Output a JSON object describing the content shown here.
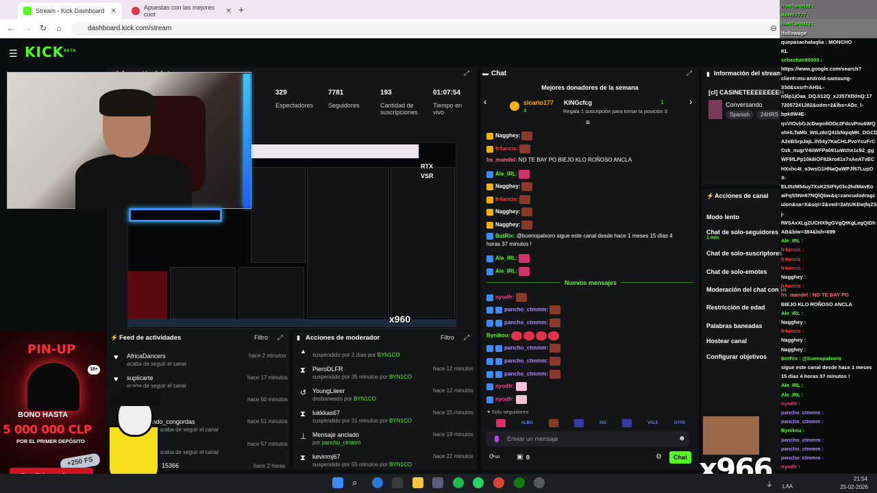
{
  "browser": {
    "tabs": [
      {
        "title": "Stream - Kick Dashboard",
        "close": "✕"
      },
      {
        "title": "Apuestas con las mejores cuot",
        "close": "✕"
      }
    ],
    "new_tab": "+",
    "url": "dashboard.kick.com/stream"
  },
  "kick": {
    "logo": "KICK",
    "logo_sup": "BETA"
  },
  "stream": {
    "title_partial": "Información del stream",
    "stats": [
      {
        "value": "329",
        "label": "Espectadores"
      },
      {
        "value": "7781",
        "label": "Seguidores"
      },
      {
        "value": "193",
        "label": "Cantidad de suscripciones"
      },
      {
        "value": "01:07:54",
        "label": "Tiempo en vivo"
      }
    ],
    "preview_labels": {
      "rtx": "RTX",
      "vsr": "VSR",
      "multiplier": "x960"
    }
  },
  "feed": {
    "title": "Feed de actividades",
    "filter": "Filtro",
    "items": [
      {
        "name": "AfricaDancers",
        "sub": "acaba de seguir el canal",
        "time": "hace 2 minutos"
      },
      {
        "name": "suplicarte",
        "sub": "acaba de seguir el canal",
        "time": "hace 17 minutos"
      },
      {
        "name": "",
        "sub": "",
        "time": "hace 50 minutos"
      },
      {
        "name": "mondo_congordas",
        "sub": "acaba de seguir el canal",
        "time": "hace 51 minutos"
      },
      {
        "name": "",
        "sub": "acaba de seguir el canal",
        "time": "hace 57 minutos"
      },
      {
        "name": "15366",
        "sub": "",
        "time": "hace 2 horas"
      }
    ]
  },
  "mod": {
    "title": "Acciones de moderador",
    "filter": "Filtro",
    "items": [
      {
        "name": "",
        "sub": "suspendido por 2 días por",
        "by": "BYN1CO",
        "time": ""
      },
      {
        "name": "PieroDLFR",
        "sub": "suspendido por 35 minutos por",
        "by": "BYN1CO",
        "time": "hace 12 minutos"
      },
      {
        "name": "YoungLiieer",
        "sub": "desbaneado por",
        "by": "BYN1CO",
        "time": "hace 12 minutos"
      },
      {
        "name": "lukkkas67",
        "sub": "suspendido por 31 minutos por",
        "by": "BYN1CO",
        "time": "hace 15 minutos"
      },
      {
        "name": "Mensaje anclado",
        "sub": "por",
        "by": "pancho_ctmmm",
        "time": "hace 19 minutos"
      },
      {
        "name": "kevinmj67",
        "sub": "suspendido por 55 minutos por",
        "by": "BYN1CO",
        "time": "hace 22 minutos"
      }
    ]
  },
  "chat": {
    "title": "Chat",
    "top_donors_title": "Mejores donadores de la semana",
    "donor1": {
      "name": "sicario177",
      "count": "4"
    },
    "donor2": {
      "name": "KINGcfcg",
      "count": "1",
      "sub": "Regala 1 suscripción para tomar la posición 3"
    },
    "messages": [
      {
        "user": "Nagghey:",
        "text": "",
        "color": "#ffffff"
      },
      {
        "user": "fr4ancis:",
        "text": "",
        "color": "#ff3b3b"
      },
      {
        "user": "hs_mandel:",
        "text": "NO TE BAY PO BIEJO KLO ROÑOSO ANCLA",
        "color": "#ff6b8a"
      },
      {
        "user": "Ale_IRL:",
        "text": "",
        "color": "#53fc18"
      },
      {
        "user": "Nagghey:",
        "text": "",
        "color": "#ffffff"
      },
      {
        "user": "fr4ancis:",
        "text": "",
        "color": "#ff3b3b"
      },
      {
        "user": "Nagghey:",
        "text": "",
        "color": "#ffffff"
      },
      {
        "user": "Nagghey:",
        "text": "",
        "color": "#ffffff"
      },
      {
        "user": "BotRix:",
        "text": "@buenopalxoro sigue este canal desde hace 1 meses 15 días 4",
        "color": "#53fc18"
      },
      {
        "user": "",
        "text": "horas 37 minutos !",
        "color": "#ffffff"
      },
      {
        "user": "Ale_IRL:",
        "text": "",
        "color": "#53fc18"
      },
      {
        "user": "Ale_IRL:",
        "text": "",
        "color": "#53fc18"
      }
    ],
    "new_messages": "Nuevos mensajes",
    "new": [
      {
        "user": "nyodfr:",
        "color": "#ff3b8a"
      },
      {
        "user": "pancho_ctmmm:",
        "color": "#b18cff"
      },
      {
        "user": "pancho_ctmmm:",
        "color": "#b18cff"
      },
      {
        "user": "Bynikou:",
        "color": "#53fc18"
      },
      {
        "user": "pancho_ctmmm:",
        "color": "#b18cff"
      },
      {
        "user": "pancho_ctmmm:",
        "color": "#b18cff"
      },
      {
        "user": "pancho_ctmmm:",
        "color": "#b18cff"
      },
      {
        "user": "nyodfr:",
        "color": "#ff3b8a"
      },
      {
        "user": "nyodfr:",
        "color": "#ff3b8a"
      }
    ],
    "followers_only": "Solo seguidores",
    "emote_labels": [
      "ALBO",
      "SIU",
      "VALE",
      "GYPE"
    ],
    "input_placeholder": "Enviar un mensaje",
    "points": "0",
    "send": "Chat"
  },
  "info": {
    "title": "Información del stream",
    "stream_name": "[cl] CASINETEEEEEEEEH",
    "category": "Conversando",
    "tags": [
      "Spanish",
      "24HRS"
    ]
  },
  "actions": {
    "title": "Acciones de canal",
    "items": [
      {
        "label": "Modo lento",
        "sub": ""
      },
      {
        "label": "Chat de solo-seguidores",
        "sub": "1 min"
      },
      {
        "label": "Chat de solo-suscriptores",
        "sub": ""
      },
      {
        "label": "Chat de solo-emotes",
        "sub": ""
      },
      {
        "label": "Moderación del chat con IA",
        "sub": ""
      },
      {
        "label": "Restricción de edad",
        "sub": ""
      },
      {
        "label": "Palabras baneadas",
        "sub": ""
      },
      {
        "label": "Hostear canal",
        "sub": ""
      },
      {
        "label": "Configurar objetivos",
        "sub": ""
      }
    ]
  },
  "overlay_chat": [
    {
      "text": "huerfanozzz :",
      "color": "#53fc18"
    },
    {
      "text": "AcHE7777 :",
      "color": "#53fc18"
    },
    {
      "text": "huerfanozzz :",
      "color": "#53fc18"
    },
    {
      "text": "!followage",
      "color": "#ffffff"
    },
    {
      "text": "quepasachalaqlia : MONCHO",
      "color": "#ffffff"
    },
    {
      "text": "KL",
      "color": "#ffffff"
    },
    {
      "text": "sebastian89903 :",
      "color": "#53fc18"
    },
    {
      "text": "https://www.google.com/search?",
      "color": "#ffffff"
    },
    {
      "text": "client=ms-android-samsung-",
      "color": "#ffffff"
    },
    {
      "text": "33d&sxsrf=AHbL-",
      "color": "#ffffff"
    },
    {
      "text": "n5lp1jOaa_DQJi12Q_xJ357XD0nQ:17",
      "color": "#ffffff"
    },
    {
      "text": "72057241282&udm=2&lbs=ADc_l-",
      "color": "#ffffff"
    },
    {
      "text": "bpk8W4E-",
      "color": "#ffffff"
    },
    {
      "text": "qsVIOvbGJcDwpn6ODc2FdcvPnu6WQ",
      "color": "#ffffff"
    },
    {
      "text": "ohHLTaMb_WtLz8zQ41bNqiqMK_DGCD",
      "color": "#ffffff"
    },
    {
      "text": "A2eBSrpJajL.lh54y7KaCHLPvoYcuFrC",
      "color": "#ffffff"
    },
    {
      "text": "Ozk_nugrV4iiWFPa091uWzhe1c92_gg",
      "color": "#ffffff"
    },
    {
      "text": "WF9fLPp10k8iOF82kro81x7xAeATvEC",
      "color": "#ffffff"
    },
    {
      "text": "HXxhc4t_o3wsG1HNaQaWPJf67LupO",
      "color": "#ffffff"
    },
    {
      "text": "X-",
      "color": "#ffffff"
    },
    {
      "text": "EL0tzM54uy7XsK2SIFty03c2hdMavEo",
      "color": "#ffffff"
    },
    {
      "text": "aiFqS5Nn67NQlQbw&q=zancudodragc",
      "color": "#ffffff"
    },
    {
      "text": "ulon&sa=X&sqi=2&ved=2ahUKEwjfqZS",
      "color": "#ffffff"
    },
    {
      "text": "j-",
      "color": "#ffffff"
    },
    {
      "text": "fWSAxXLgZUCHX9gGVgQtKgLegQIDh",
      "color": "#ffffff"
    },
    {
      "text": "AB&biw=384&bih=699",
      "color": "#ffffff"
    },
    {
      "text": "Ale_IRL :",
      "color": "#53fc18"
    },
    {
      "text": "fr4ancis :",
      "color": "#ff3b3b"
    },
    {
      "text": "fr4ancis :",
      "color": "#ff3b3b"
    },
    {
      "text": "fr4ancis :",
      "color": "#ff3b3b"
    },
    {
      "text": "Nagghey :",
      "color": "#ffffff"
    },
    {
      "text": "fr4ancis :",
      "color": "#ff3b3b"
    },
    {
      "text": "hs_mandel : NO TE BAY PO",
      "color": "#ff6b8a"
    },
    {
      "text": "BIEJO KLO ROÑOSO ANCLA",
      "color": "#ffffff"
    },
    {
      "text": "Ale_IRL :",
      "color": "#53fc18"
    },
    {
      "text": "Nagghey :",
      "color": "#ffffff"
    },
    {
      "text": "fr4ancis :",
      "color": "#ff3b3b"
    },
    {
      "text": "Nagghey :",
      "color": "#ffffff"
    },
    {
      "text": "Nagghey :",
      "color": "#ffffff"
    },
    {
      "text": "BotRix : @buenopalxoro",
      "color": "#53fc18"
    },
    {
      "text": "sigue este canal desde hace 1 meses",
      "color": "#ffffff"
    },
    {
      "text": "15 días 4 horas 37 minutos !",
      "color": "#ffffff"
    },
    {
      "text": "Ale_IRL :",
      "color": "#53fc18"
    },
    {
      "text": "Ale_IRL :",
      "color": "#53fc18"
    },
    {
      "text": "nyodfr :",
      "color": "#ff3b8a"
    },
    {
      "text": "pancho_ctmmm :",
      "color": "#b18cff"
    },
    {
      "text": "pancho_ctmmm :",
      "color": "#b18cff"
    },
    {
      "text": "Bynikou :",
      "color": "#53fc18"
    },
    {
      "text": "pancho_ctmmm :",
      "color": "#b18cff"
    },
    {
      "text": "pancho_ctmmm :",
      "color": "#b18cff"
    },
    {
      "text": "pancho_ctmmm :",
      "color": "#b18cff"
    },
    {
      "text": "nyodfr :",
      "color": "#ff3b8a"
    }
  ],
  "ad": {
    "logo": "PIN-UP",
    "age": "18+",
    "bono": "BONO HASTA",
    "amount": "5 000 000 CLP",
    "sub": "POR EL PRIMER DEPÓSITO",
    "fs": "+250 FS",
    "button": "Recibir un bono"
  },
  "meme_text": "x966",
  "taskbar": {
    "lang": "LAA",
    "time": "21:54",
    "date": "25-02-2026"
  },
  "colors": {
    "accent": "#53fc18",
    "panel": "#141517",
    "bg": "#0b0e0f"
  }
}
